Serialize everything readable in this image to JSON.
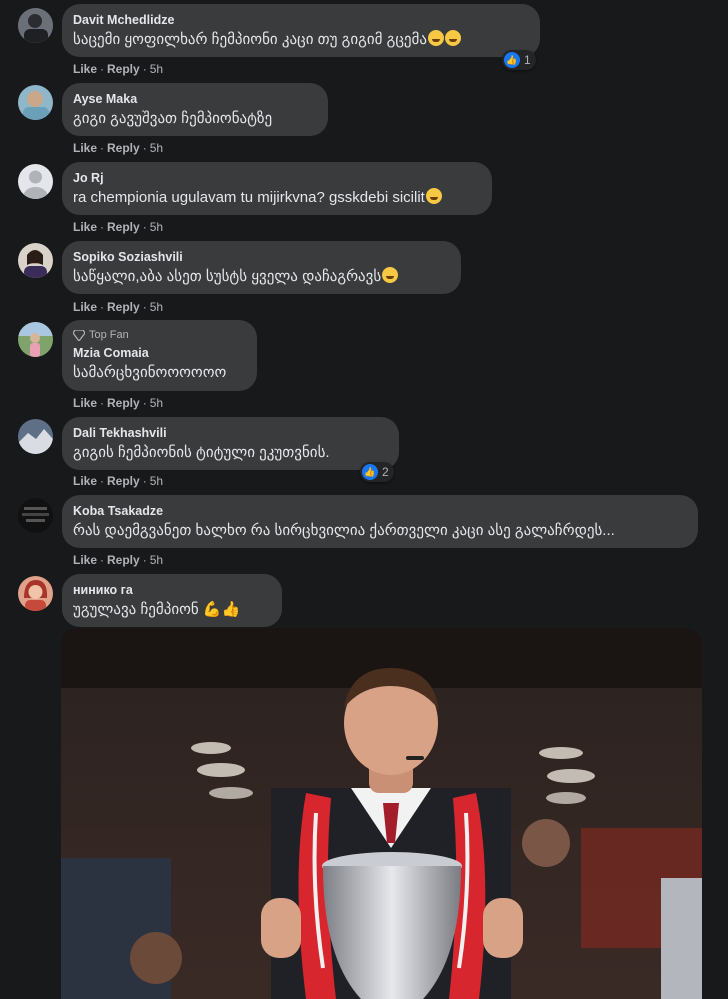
{
  "comments": [
    {
      "name": "Davit Mchedlidze",
      "text": "საცემი ყოფილხარ ჩემპიონი კაცი თუ გიგიმ გცემა",
      "like": "Like",
      "reply": "Reply",
      "time": "5h",
      "reactions": "1"
    },
    {
      "name": "Ayse Maka",
      "text": "გიგი გავუშვათ ჩემპიონატზე",
      "like": "Like",
      "reply": "Reply",
      "time": "5h"
    },
    {
      "name": "Jo Rj",
      "text": "ra chempionia ugulavam tu mijirkvna? gsskdebi sicilit",
      "like": "Like",
      "reply": "Reply",
      "time": "5h"
    },
    {
      "name": "Sopiko Soziashvili",
      "text": "საწყალი,აბა ასეთ სუსტს ყველა დაჩაგრავს",
      "like": "Like",
      "reply": "Reply",
      "time": "5h"
    },
    {
      "badge": "Top Fan",
      "name": "Mzia Comaia",
      "text": "სამარცხვინოოოოოო",
      "like": "Like",
      "reply": "Reply",
      "time": "5h"
    },
    {
      "name": "Dali Tekhashvili",
      "text": "გიგის ჩემპიონის ტიტული ეკუთვნის.",
      "like": "Like",
      "reply": "Reply",
      "time": "5h",
      "reactions": "2"
    },
    {
      "name": "Koba Tsakadze",
      "text": "რას დაემგვანეთ ხალხო რა სირცხვილია ქართველი კაცი ასე გალაჩრდეს...",
      "like": "Like",
      "reply": "Reply",
      "time": "5h"
    },
    {
      "name": "нинико га",
      "text": "უგულავა ჩემპიონ"
    }
  ],
  "colors": {
    "background": "#18191a",
    "bubble": "#3a3b3c",
    "text": "#e4e6eb",
    "secondary": "#b0b3b8",
    "like_blue": "#1877f2"
  },
  "icons": [
    "thumbs-up-icon",
    "diamond-icon",
    "laughing-emoji-icon",
    "flexed-biceps-emoji-icon",
    "thumbs-up-emoji-icon"
  ]
}
